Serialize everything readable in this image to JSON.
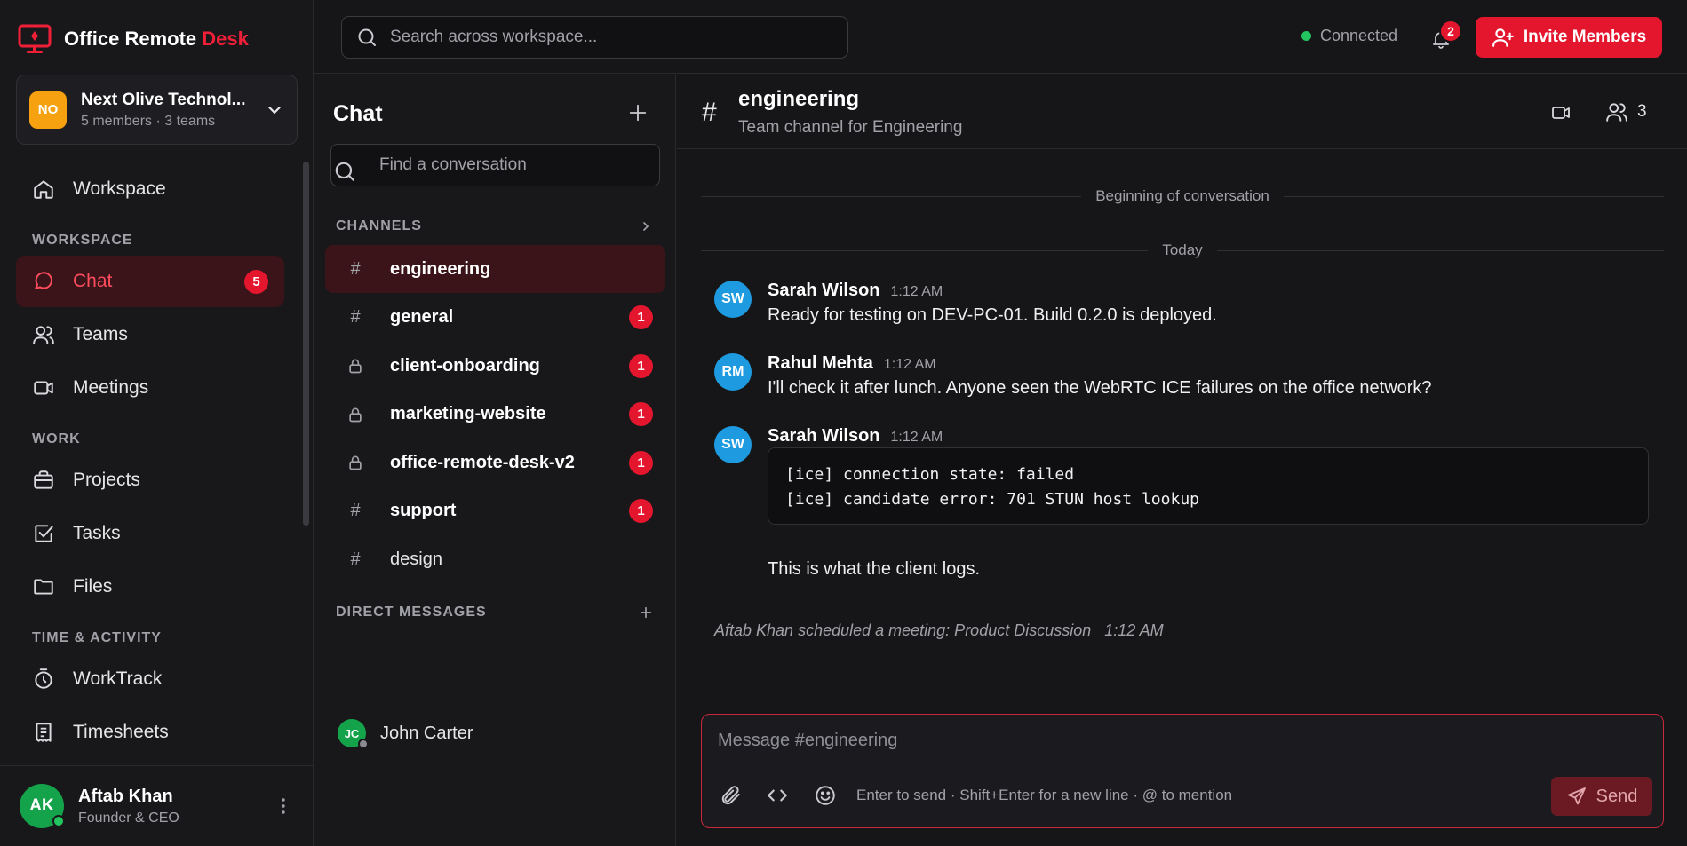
{
  "brand": {
    "name": "Office Remote",
    "accent": "Desk"
  },
  "org": {
    "initials": "NO",
    "name": "Next Olive Technol...",
    "meta": "5 members · 3 teams"
  },
  "nav": {
    "workspace": "Workspace",
    "section_workspace": "WORKSPACE",
    "chat": "Chat",
    "chat_badge": "5",
    "teams": "Teams",
    "meetings": "Meetings",
    "section_work": "WORK",
    "projects": "Projects",
    "tasks": "Tasks",
    "files": "Files",
    "section_time": "TIME & ACTIVITY",
    "worktrack": "WorkTrack",
    "timesheets": "Timesheets"
  },
  "user": {
    "initials": "AK",
    "name": "Aftab Khan",
    "role": "Founder & CEO"
  },
  "topbar": {
    "search_placeholder": "Search across workspace...",
    "status": "Connected",
    "notifications": "2",
    "invite_label": "Invite Members"
  },
  "chatlist": {
    "title": "Chat",
    "search_placeholder": "Find a conversation",
    "channels_header": "CHANNELS",
    "channels": [
      {
        "name": "engineering",
        "icon": "hash",
        "badge": "",
        "active": true
      },
      {
        "name": "general",
        "icon": "hash",
        "badge": "1"
      },
      {
        "name": "client-onboarding",
        "icon": "lock",
        "badge": "1"
      },
      {
        "name": "marketing-website",
        "icon": "lock",
        "badge": "1"
      },
      {
        "name": "office-remote-desk-v2",
        "icon": "lock",
        "badge": "1"
      },
      {
        "name": "support",
        "icon": "hash",
        "badge": "1"
      },
      {
        "name": "design",
        "icon": "hash",
        "badge": ""
      }
    ],
    "dm_header": "DIRECT MESSAGES",
    "dms": [
      {
        "initials": "JC",
        "name": "John Carter"
      }
    ]
  },
  "conversation": {
    "hash": "#",
    "title": "engineering",
    "description": "Team channel for Engineering",
    "member_count": "3",
    "begin_label": "Beginning of conversation",
    "day_label": "Today",
    "messages": [
      {
        "initials": "SW",
        "author": "Sarah Wilson",
        "time": "1:12 AM",
        "text": "Ready for testing on DEV-PC-01. Build 0.2.0 is deployed."
      },
      {
        "initials": "RM",
        "author": "Rahul Mehta",
        "time": "1:12 AM",
        "text": "I'll check it after lunch. Anyone seen the WebRTC ICE failures on the office network?"
      },
      {
        "initials": "SW",
        "author": "Sarah Wilson",
        "time": "1:12 AM",
        "code": [
          "[ice] connection state: failed",
          "[ice] candidate error: 701 STUN host lookup"
        ],
        "text": "This is what the client logs."
      }
    ],
    "system_message": "Aftab Khan scheduled a meeting: Product Discussion",
    "system_time": "1:12 AM"
  },
  "composer": {
    "placeholder": "Message #engineering",
    "hint": "Enter to send · Shift+Enter for a new line · @ to mention",
    "send_label": "Send"
  },
  "colors": {
    "accent": "#e3162e",
    "active_bg": "#3a1419",
    "online": "#22c55e",
    "org_avatar": "#f5a110",
    "msg_avatar": "#1e9be0",
    "user_avatar": "#14a34a"
  }
}
